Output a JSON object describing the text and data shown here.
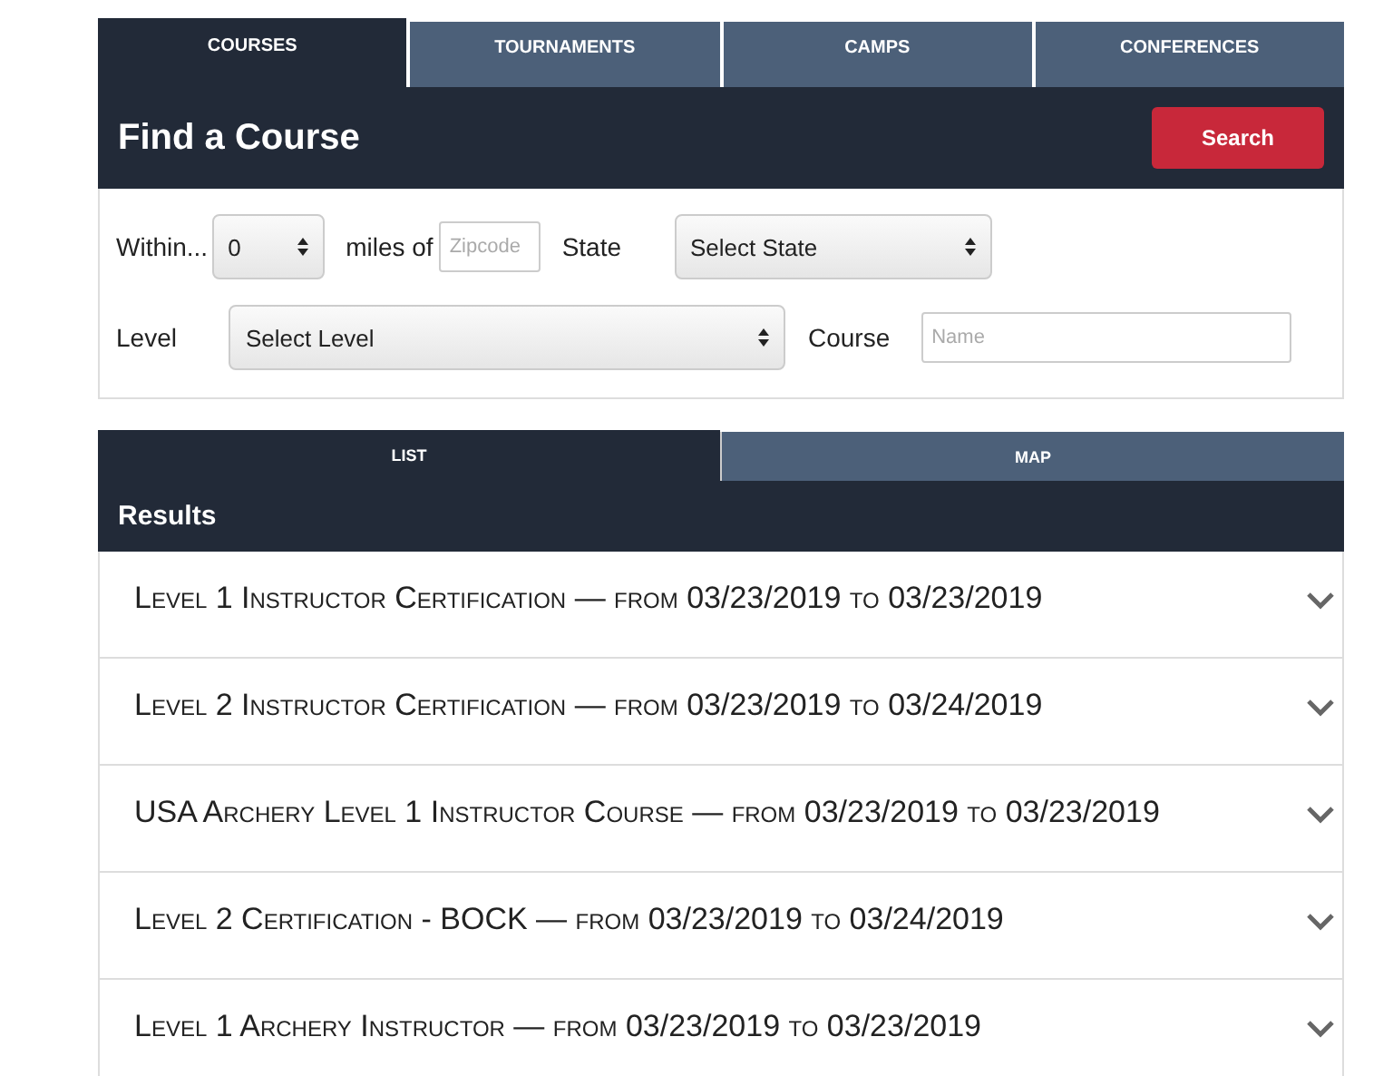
{
  "tabs": [
    {
      "label": "COURSES",
      "selected": true
    },
    {
      "label": "TOURNAMENTS",
      "selected": false
    },
    {
      "label": "CAMPS",
      "selected": false
    },
    {
      "label": "CONFERENCES",
      "selected": false
    }
  ],
  "header": {
    "title": "Find a Course",
    "search_button": "Search"
  },
  "filters": {
    "within_label": "Within...",
    "distance": "0",
    "miles_label": "miles of",
    "zipcode": {
      "placeholder": "Zipcode"
    },
    "state_label": "State",
    "state": "Select State",
    "level_label": "Level",
    "level": "Select Level",
    "course_label": "Course",
    "course": {
      "placeholder": "Name"
    }
  },
  "view_tabs": [
    {
      "label": "LIST",
      "selected": true
    },
    {
      "label": "MAP",
      "selected": false
    }
  ],
  "results": {
    "title": "Results",
    "items": [
      {
        "title": "Level 1 Instructor Certification — from 03/23/2019 to 03/23/2019",
        "expanded": false
      },
      {
        "title": "Level 2 Instructor Certification — from 03/23/2019 to 03/24/2019",
        "expanded": false
      },
      {
        "title": "USA Archery Level 1 Instructor Course — from 03/23/2019 to 03/23/2019",
        "expanded": false
      },
      {
        "title": "Level 2 Certification - BOCK — from 03/23/2019 to 03/24/2019",
        "expanded": false
      },
      {
        "title": "Level 1 Archery Instructor — from 03/23/2019 to 03/23/2019",
        "expanded": false
      }
    ]
  }
}
